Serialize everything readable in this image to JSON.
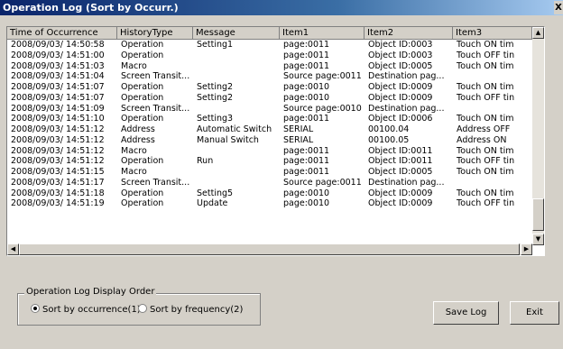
{
  "window": {
    "title": "Operation Log (Sort by Occurr.)",
    "close_glyph": "X"
  },
  "columns": [
    "Time of Occurrence",
    "HistoryType",
    "Message",
    "Item1",
    "Item2",
    "Item3"
  ],
  "rows": [
    [
      "2008/09/03/ 14:50:58",
      "Operation",
      "Setting1",
      "page:0011",
      "Object ID:0003",
      "Touch ON tim"
    ],
    [
      "2008/09/03/ 14:51:00",
      "Operation",
      "",
      "page:0011",
      "Object ID:0003",
      "Touch OFF tin"
    ],
    [
      "2008/09/03/ 14:51:03",
      "Macro",
      "",
      "page:0011",
      "Object ID:0005",
      "Touch ON tim"
    ],
    [
      "2008/09/03/ 14:51:04",
      "Screen Transit...",
      "",
      "Source page:0011",
      "Destination pag...",
      ""
    ],
    [
      "2008/09/03/ 14:51:07",
      "Operation",
      "Setting2",
      "page:0010",
      "Object ID:0009",
      "Touch ON tim"
    ],
    [
      "2008/09/03/ 14:51:07",
      "Operation",
      "Setting2",
      "page:0010",
      "Object ID:0009",
      "Touch OFF tin"
    ],
    [
      "2008/09/03/ 14:51:09",
      "Screen Transit...",
      "",
      "Source page:0010",
      "Destination pag...",
      ""
    ],
    [
      "2008/09/03/ 14:51:10",
      "Operation",
      "Setting3",
      "page:0011",
      "Object ID:0006",
      "Touch ON tim"
    ],
    [
      "2008/09/03/ 14:51:12",
      "Address",
      "Automatic Switch",
      "SERIAL",
      "00100.04",
      "Address OFF"
    ],
    [
      "2008/09/03/ 14:51:12",
      "Address",
      "Manual Switch",
      "SERIAL",
      "00100.05",
      "Address ON"
    ],
    [
      "2008/09/03/ 14:51:12",
      "Macro",
      "",
      "page:0011",
      "Object ID:0011",
      "Touch ON tim"
    ],
    [
      "2008/09/03/ 14:51:12",
      "Operation",
      "Run",
      "page:0011",
      "Object ID:0011",
      "Touch OFF tin"
    ],
    [
      "2008/09/03/ 14:51:15",
      "Macro",
      "",
      "page:0011",
      "Object ID:0005",
      "Touch ON tim"
    ],
    [
      "2008/09/03/ 14:51:17",
      "Screen Transit...",
      "",
      "Source page:0011",
      "Destination pag...",
      ""
    ],
    [
      "2008/09/03/ 14:51:18",
      "Operation",
      "Setting5",
      "page:0010",
      "Object ID:0009",
      "Touch ON tim"
    ],
    [
      "2008/09/03/ 14:51:19",
      "Operation",
      "Update",
      "page:0010",
      "Object ID:0009",
      "Touch OFF tin"
    ]
  ],
  "display_order": {
    "group_label": "Operation Log Display Order",
    "options": [
      {
        "label": "Sort by occurrence(1)",
        "selected": true
      },
      {
        "label": "Sort by frequency(2)",
        "selected": false
      }
    ]
  },
  "buttons": {
    "save_log": "Save Log",
    "exit": "Exit"
  }
}
